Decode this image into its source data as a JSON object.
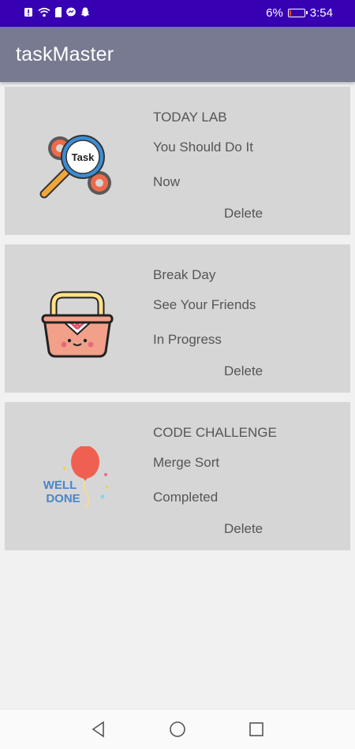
{
  "status_bar": {
    "battery_percent": "6%",
    "time": "3:54",
    "battery_color": "#ff3b30",
    "icons": [
      "alert-icon",
      "wifi-icon",
      "sim-icon",
      "messenger-icon",
      "snapchat-icon"
    ]
  },
  "app_bar": {
    "title": "taskMaster",
    "color": "#787a91"
  },
  "tasks": [
    {
      "title": "TODAY LAB",
      "description": "You Should Do It",
      "status": "Now",
      "delete_label": "Delete",
      "image": "task-gears-magnifier-icon"
    },
    {
      "title": "Break Day",
      "description": "See Your Friends",
      "status": "In Progress",
      "delete_label": "Delete",
      "image": "picnic-basket-icon"
    },
    {
      "title": "CODE CHALLENGE",
      "description": "Merge Sort",
      "status": "Completed",
      "delete_label": "Delete",
      "image": "well-done-balloon-icon",
      "image_text": "WELL DONE"
    }
  ],
  "nav_bar": {
    "buttons": [
      "back-icon",
      "home-icon",
      "recents-icon"
    ]
  }
}
